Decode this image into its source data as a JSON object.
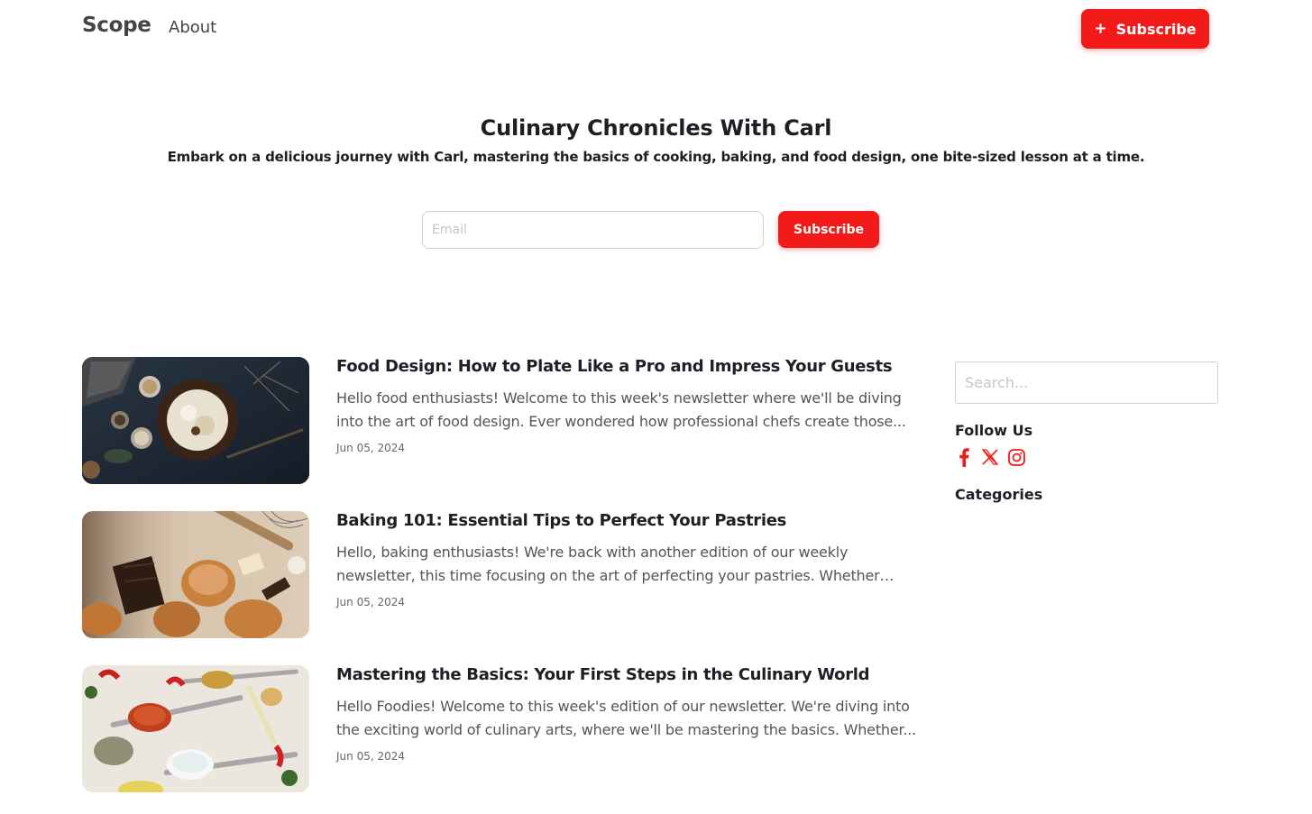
{
  "header": {
    "logo": "Scope",
    "nav": {
      "about_label": "About"
    },
    "subscribe_label": "Subscribe",
    "subscribe_icon": "plus-icon"
  },
  "hero": {
    "title": "Culinary Chronicles With Carl",
    "subtitle": "Embark on a delicious journey with Carl, mastering the basics of cooking, baking, and food design, one bite-sized lesson at a time.",
    "email_placeholder": "Email",
    "subscribe_label": "Subscribe"
  },
  "posts": [
    {
      "title": "Food Design: How to Plate Like a Pro and Impress Your Guests",
      "excerpt": "Hello food enthusiasts! Welcome to this week's newsletter where we'll be diving into the art of food design. Ever wondered how professional chefs create those...",
      "date": "Jun 05, 2024",
      "image": "plated-dessert-dark-table-photo"
    },
    {
      "title": "Baking 101: Essential Tips to Perfect Your Pastries",
      "excerpt": "Hello, baking enthusiasts! We're back with another edition of our weekly newsletter, this time focusing on the art of perfecting your pastries. Whether you'r...",
      "date": "Jun 05, 2024",
      "image": "pastries-and-chocolate-photo"
    },
    {
      "title": "Mastering the Basics: Your First Steps in the Culinary World",
      "excerpt": "Hello Foodies! Welcome to this week's edition of our newsletter. We're diving into the exciting world of culinary arts, where we'll be mastering the basics. Whether...",
      "date": "Jun 05, 2024",
      "image": "spices-in-spoons-photo"
    }
  ],
  "sidebar": {
    "search_placeholder": "Search...",
    "follow_heading": "Follow Us",
    "socials": [
      "facebook-icon",
      "x-icon",
      "instagram-icon"
    ],
    "categories_heading": "Categories"
  },
  "colors": {
    "accent": "#f31a1a",
    "text": "#1c1f26",
    "muted": "#555555"
  }
}
